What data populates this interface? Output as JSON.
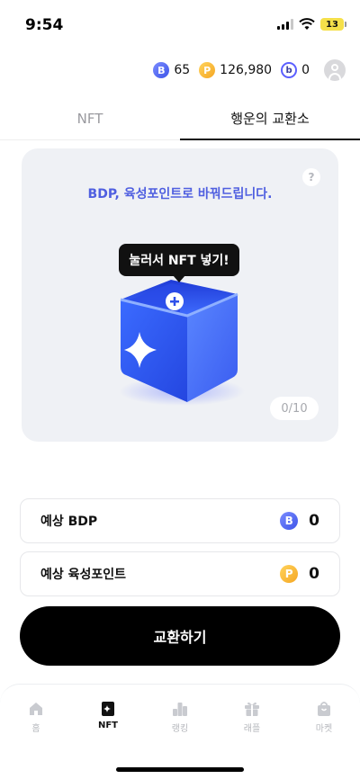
{
  "status_bar": {
    "time": "9:54",
    "battery": "13"
  },
  "points": {
    "bdp": {
      "icon": "B",
      "value": "65"
    },
    "pp": {
      "icon": "P",
      "value": "126,980"
    },
    "b": {
      "icon": "b",
      "value": "0"
    }
  },
  "tabs": [
    {
      "label": "NFT",
      "active": false
    },
    {
      "label": "행운의 교환소",
      "active": true
    }
  ],
  "card": {
    "title": "BDP, 육성포인트로 바꿔드립니다.",
    "help": "?",
    "tooltip": "눌러서 NFT 넣기!",
    "counter": "0/10"
  },
  "expected": {
    "bdp": {
      "label": "예상 BDP",
      "icon": "B",
      "value": "0"
    },
    "pp": {
      "label": "예상 육성포인트",
      "icon": "P",
      "value": "0"
    }
  },
  "exchange_button": "교환하기",
  "nav": [
    {
      "label": "홈",
      "icon": "home-icon",
      "active": false
    },
    {
      "label": "NFT",
      "icon": "nft-icon",
      "active": true
    },
    {
      "label": "랭킹",
      "icon": "ranking-icon",
      "active": false
    },
    {
      "label": "래플",
      "icon": "gift-icon",
      "active": false
    },
    {
      "label": "마켓",
      "icon": "shop-icon",
      "active": false
    }
  ],
  "colors": {
    "accent": "#4f5fe0",
    "bdp": "#3d54e8",
    "pp": "#f5a623",
    "box": "#3a63ff"
  }
}
